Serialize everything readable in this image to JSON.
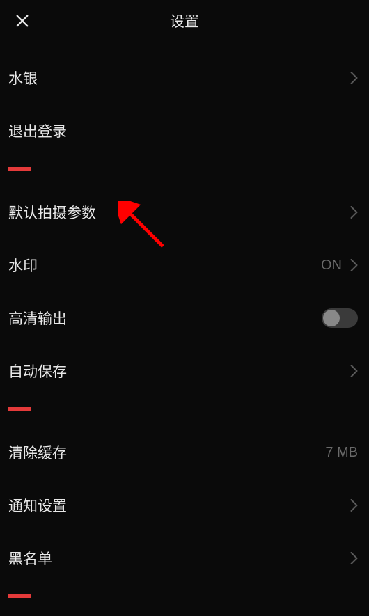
{
  "header": {
    "title": "设置"
  },
  "rows": {
    "account": {
      "label": "水银"
    },
    "logout": {
      "label": "退出登录"
    },
    "shoot_params": {
      "label": "默认拍摄参数"
    },
    "watermark": {
      "label": "水印",
      "value": "ON"
    },
    "hd_output": {
      "label": "高清输出"
    },
    "autosave": {
      "label": "自动保存"
    },
    "clear_cache": {
      "label": "清除缓存",
      "value": "7 MB"
    },
    "notifications": {
      "label": "通知设置"
    },
    "blacklist": {
      "label": "黑名单"
    }
  },
  "colors": {
    "accent": "#e43a3a",
    "arrow": "#ff0000"
  }
}
